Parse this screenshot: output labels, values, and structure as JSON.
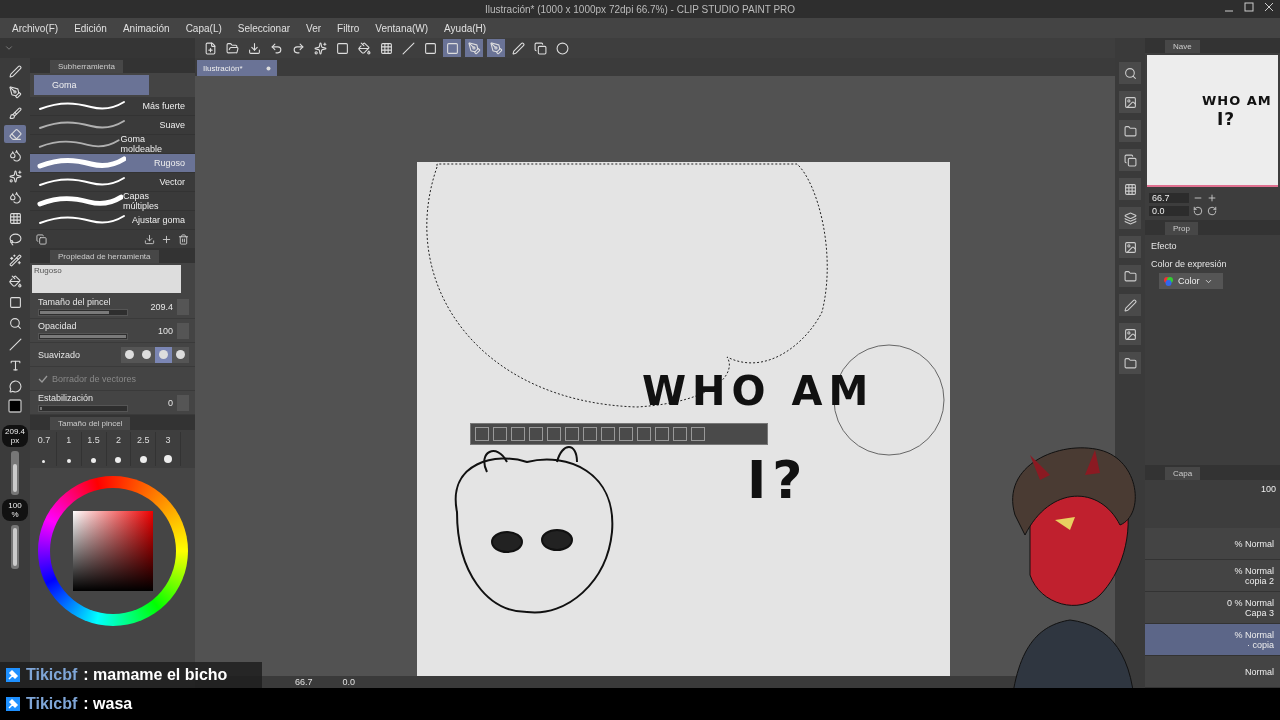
{
  "window": {
    "title": "Ilustración* (1000 x 1000px 72dpi 66.7%) - CLIP STUDIO PAINT PRO"
  },
  "menu": [
    "Archivo(F)",
    "Edición",
    "Animación",
    "Capa(L)",
    "Seleccionar",
    "Ver",
    "Filtro",
    "Ventana(W)",
    "Ayuda(H)"
  ],
  "document_tab": {
    "label": "Ilustración*",
    "selected": true
  },
  "subtool_panel": {
    "title": "Subherramienta",
    "group": "Goma",
    "items": [
      {
        "label": "Más fuerte",
        "selected": false
      },
      {
        "label": "Suave",
        "selected": false
      },
      {
        "label": "Goma moldeable",
        "selected": false
      },
      {
        "label": "Rugoso",
        "selected": true
      },
      {
        "label": "Vector",
        "selected": false
      },
      {
        "label": "Capas múltiples",
        "selected": false
      },
      {
        "label": "Ajustar goma",
        "selected": false
      }
    ]
  },
  "tool_property": {
    "title": "Propiedad de herramienta",
    "preview": "Rugoso",
    "rows": [
      {
        "kind": "value",
        "label": "Tamaño del pincel",
        "value": "209.4",
        "level": 0.8
      },
      {
        "kind": "value",
        "label": "Opacidad",
        "value": "100",
        "level": 1
      },
      {
        "kind": "choice",
        "label": "Suavizado",
        "options": [
          {
            "selected": false
          },
          {
            "selected": false
          },
          {
            "selected": true
          },
          {
            "selected": false
          }
        ]
      },
      {
        "kind": "check",
        "label": "Borrador de vectores",
        "checked": true
      },
      {
        "kind": "value",
        "label": "Estabilización",
        "value": "0",
        "level": 0
      }
    ]
  },
  "brush_size_panel": {
    "title": "Tamaño del pincel",
    "sizes": [
      "0.7",
      "1",
      "1.5",
      "2",
      "2.5",
      "3"
    ]
  },
  "size_indicator": {
    "value": "209.4",
    "unit": "px",
    "level": 0.75
  },
  "opacity_indicator": {
    "value": "100",
    "unit": "%",
    "level": 1
  },
  "canvas": {
    "lettering": [
      "WHO AM",
      "I?"
    ],
    "zoom": "66.7",
    "angle": "0.0"
  },
  "navigator": {
    "title": "Nave",
    "zoom": "66.7",
    "angle": "0.0",
    "lettering": [
      "WHO AM",
      "I?"
    ]
  },
  "layer_property": {
    "title": "Prop",
    "sections": [
      "Efecto",
      "Color de expresión"
    ],
    "expression_color": "Color"
  },
  "layer_panel": {
    "title": "Capa",
    "opacity": "100",
    "rows": [
      {
        "mode": "% Normal",
        "selected": false
      },
      {
        "mode": "% Normal",
        "name": "copia 2",
        "selected": false
      },
      {
        "mode": "0 % Normal",
        "name": "Capa 3",
        "selected": false
      },
      {
        "mode": "% Normal",
        "name": "· copia",
        "selected": true
      },
      {
        "mode": "Normal",
        "selected": false
      }
    ]
  },
  "chat": [
    {
      "user": "Tikicbf",
      "message": ": mamame el bicho"
    },
    {
      "user": "Tikicbf",
      "message": ": wasa"
    }
  ]
}
